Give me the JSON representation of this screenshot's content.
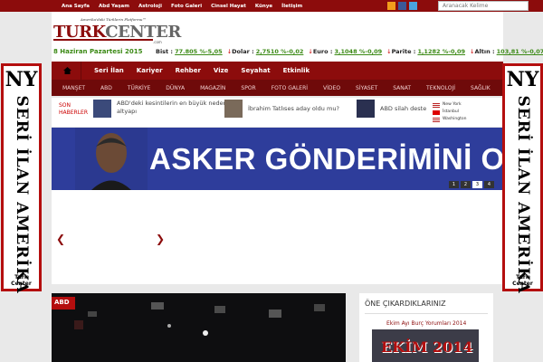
{
  "topnav": [
    "Ana Sayfa",
    "Abd Yaşam",
    "Astroloji",
    "Foto Galeri",
    "Cinsel Hayat",
    "Künye",
    "İletişim"
  ],
  "search": {
    "placeholder": "Aranacak Kelime"
  },
  "logo": {
    "tagline": "Amerika'daki Türklerin Platformu™",
    "main_red": "TURK",
    "main_gray": "CENTER",
    "domain": ".com"
  },
  "date": "8 Haziran Pazartesi 2015",
  "ticker": [
    {
      "label": "Bist :",
      "value": "77.805 %-5,05"
    },
    {
      "label": "Dolar :",
      "value": "2,7510 %-0,02"
    },
    {
      "label": "Euro :",
      "value": "3,1048 %-0,09"
    },
    {
      "label": "Parite :",
      "value": "1,1282 %-0,09"
    },
    {
      "label": "Altın :",
      "value": "103,81 %-0,07"
    }
  ],
  "mainnav": [
    "Seri İlan",
    "Kariyer",
    "Rehber",
    "Vize",
    "Seyahat",
    "Etkinlik"
  ],
  "catnav": [
    "MANŞET",
    "ABD",
    "TÜRKİYE",
    "DÜNYA",
    "MAGAZİN",
    "SPOR",
    "FOTO GALERİ",
    "VİDEO",
    "SİYASET",
    "SANAT",
    "TEKNOLOJİ",
    "SAĞLIK"
  ],
  "breaking": {
    "label1": "SON",
    "label2": "HABERLER",
    "items": [
      "ABD'deki kesintilerin en büyük nedeni altyapı",
      "İbrahim Tatlıses aday oldu mu?",
      "ABD silah deste"
    ],
    "clocks": [
      "New York",
      "İstanbul",
      "Washington"
    ]
  },
  "slider": {
    "headline": "ASKER GÖNDERİMİNİ ONAYLADI",
    "pages": [
      "1",
      "2",
      "3",
      "4"
    ],
    "active_page": "3"
  },
  "side_ad": {
    "top": "NY",
    "vertical": "SERİ İLAN AMERİKA",
    "footer": "Turk Center"
  },
  "news": {
    "tag": "ABD"
  },
  "featured": {
    "title": "ÖNE ÇIKARDIKLARINIZ",
    "item": "Ekim Ayı Burç Yorumları 2014",
    "image_text": "EKİM 2014"
  },
  "colors": {
    "brand_red": "#8c0c0c",
    "nav_dark": "#6f0a0a",
    "slider_blue": "#2e3d9b",
    "green": "#3c8a16"
  }
}
